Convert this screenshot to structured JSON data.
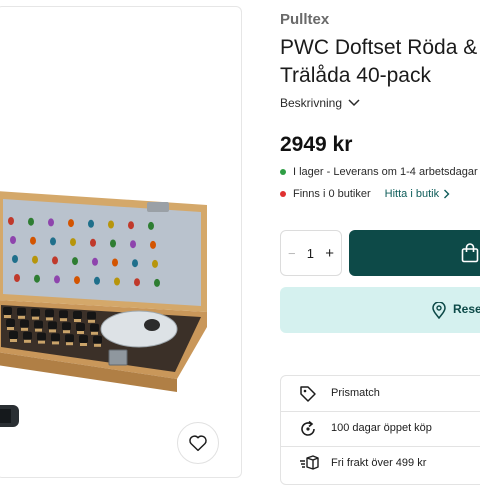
{
  "product": {
    "brand": "Pulltex",
    "title_line1": "PWC Doftset Röda &",
    "title_line2": "Trälåda 40-pack",
    "description_label": "Beskrivning",
    "price": "2949 kr"
  },
  "availability": {
    "online": "I lager - Leverans om 1-4 arbetsdagar",
    "stores": "Finns i 0 butiker",
    "find_in_store": "Hitta i butik"
  },
  "purchase": {
    "quantity": "1",
    "minus_label": "−",
    "plus_label": "+",
    "reserve_label": "Rese"
  },
  "benefits": [
    {
      "label": "Prismatch",
      "icon": "price-tag-icon"
    },
    {
      "label": "100 dagar öppet köp",
      "icon": "return-arrow-icon"
    },
    {
      "label": "Fri frakt över 499 kr",
      "icon": "delivery-box-icon"
    }
  ],
  "colors": {
    "primary": "#0d4a48",
    "secondary_bg": "#d5f1ef",
    "in_stock": "#2f9e44",
    "out_of_stock": "#e03131"
  }
}
